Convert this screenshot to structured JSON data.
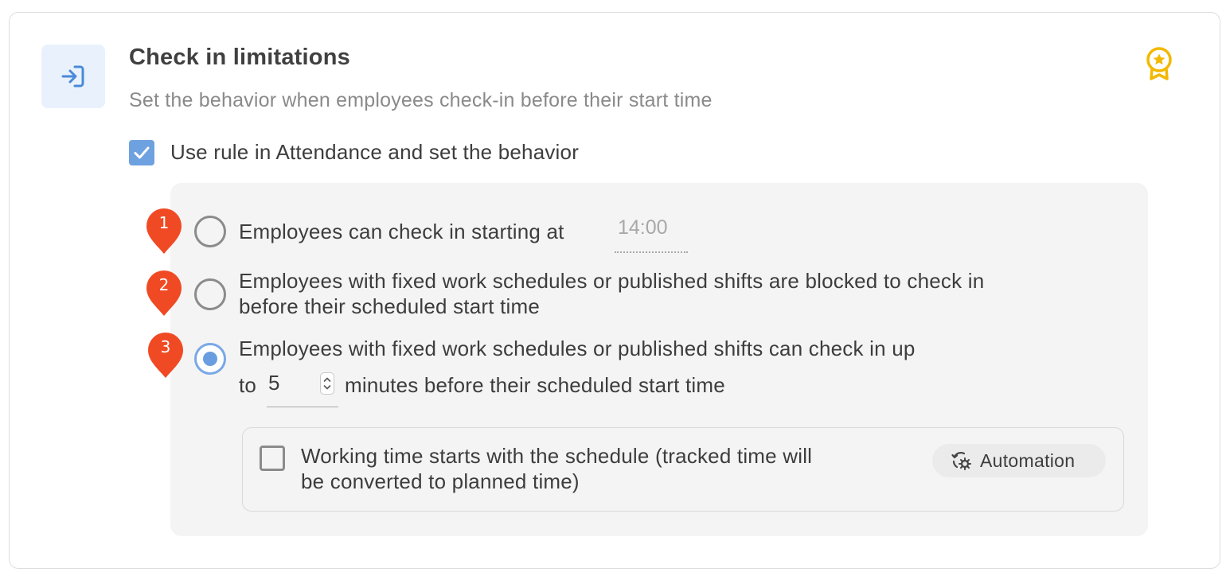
{
  "section": {
    "title": "Check in limitations",
    "subtitle": "Set the behavior when employees check-in before their start time",
    "icon": "check-in-arrow-icon",
    "badge_icon": "award-ribbon-icon"
  },
  "main_checkbox": {
    "label": "Use rule in Attendance and set the behavior",
    "checked": true
  },
  "options": [
    {
      "marker": "1",
      "label": "Employees can check in starting at",
      "time_value": "14:00",
      "selected": false
    },
    {
      "marker": "2",
      "label_line1": "Employees with fixed work schedules or published shifts are blocked to check in",
      "label_line2": "before their scheduled start time",
      "selected": false
    },
    {
      "marker": "3",
      "label_line1": "Employees with fixed work schedules or published shifts can check in up",
      "prefix": "to",
      "minutes_value": "5",
      "suffix": "minutes before their scheduled start time",
      "selected": true
    }
  ],
  "sub_option": {
    "label_line1": "Working time starts with the schedule (tracked time will",
    "label_line2": "be converted to planned time)",
    "checked": false,
    "tag_label": "Automation",
    "tag_icon": "automation-sync-gear-icon"
  },
  "colors": {
    "accent_blue": "#6ea1e0",
    "icon_tile_bg": "#e9f2fc",
    "marker_red": "#f04a24",
    "badge_gold": "#f3b800",
    "panel_bg": "#f4f4f4"
  }
}
